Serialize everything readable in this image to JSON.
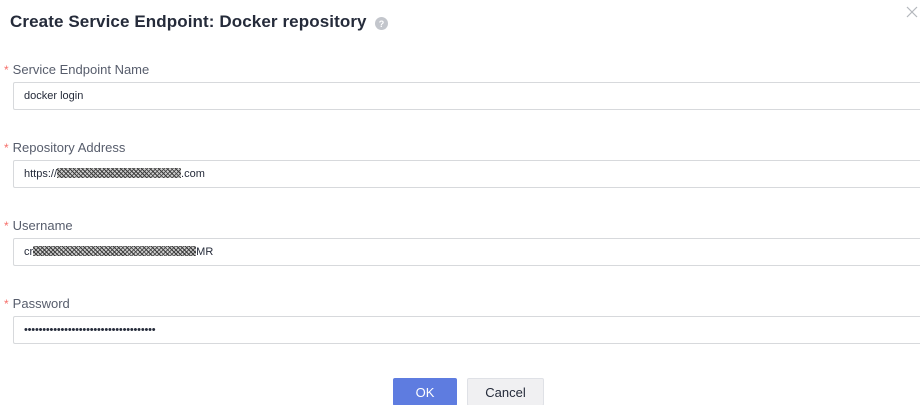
{
  "dialog": {
    "title": "Create Service Endpoint: Docker repository",
    "help_icon": "question-circle-icon",
    "close_icon": "close-icon"
  },
  "form": {
    "required_mark": "*",
    "endpoint_name": {
      "label": "Service Endpoint Name",
      "value": "docker login"
    },
    "repository_address": {
      "label": "Repository Address",
      "value_prefix": "https://",
      "value_suffix": ".com"
    },
    "username": {
      "label": "Username",
      "value_prefix": "cr",
      "value_suffix": "MR"
    },
    "password": {
      "label": "Password",
      "value": "••••••••••••••••••••••••••••••••••••"
    }
  },
  "buttons": {
    "ok_label": "OK",
    "cancel_label": "Cancel"
  },
  "colors": {
    "primary": "#5e7ce0",
    "required": "#f66f6a",
    "title": "#252b3a",
    "label": "#575d6c",
    "border": "#d7d9dc"
  }
}
